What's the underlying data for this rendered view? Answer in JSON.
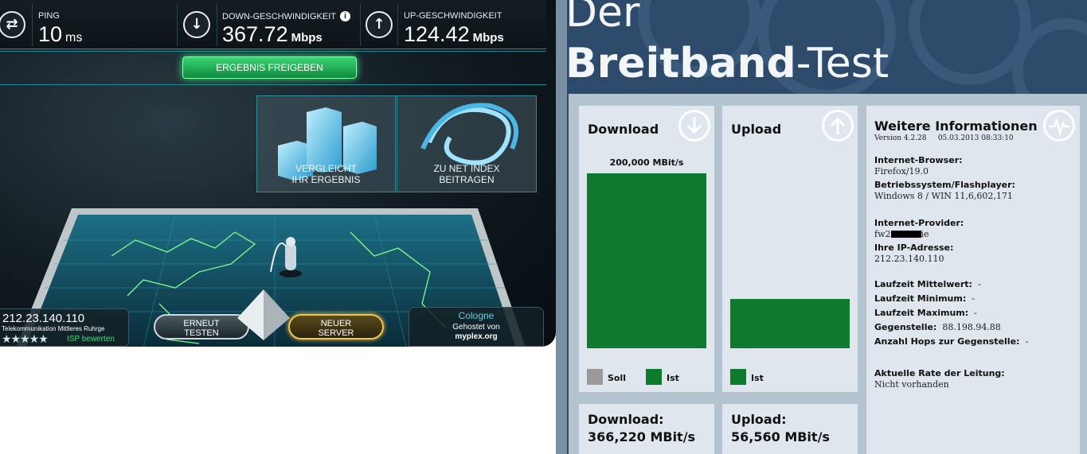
{
  "speedtest": {
    "ping": {
      "label": "PING",
      "value": "10",
      "unit": "ms",
      "icon": "exchange-arrows-icon"
    },
    "download": {
      "label": "DOWN-GESCHWINDIGKEIT",
      "value": "367.72",
      "unit": "Mbps",
      "icon": "arrow-down-icon"
    },
    "upload": {
      "label": "UP-GESCHWINDIGKEIT",
      "value": "124.42",
      "unit": "Mbps",
      "icon": "arrow-up-icon"
    },
    "info_glyph": "i",
    "share_button": "ERGEBNIS FREIGEBEN",
    "tile_compare": {
      "line1": "VERGLEICHT",
      "line2": "IHR ERGEBNIS"
    },
    "tile_netindex": {
      "line1": "ZU NET INDEX",
      "line2": "BEITRAGEN"
    },
    "client": {
      "ip": "212.23.140.110",
      "isp": "Telekommunikation Mittleres Ruhrge",
      "stars": "★★★★★",
      "rate": "ISP bewerten"
    },
    "retest_button": {
      "line1": "ERNEUT",
      "line2": "TESTEN"
    },
    "new_server_button": {
      "line1": "NEUER",
      "line2": "SERVER"
    },
    "server": {
      "city": "Cologne",
      "hosted_line1": "Gehostet von",
      "hosted_line2": "myplex.org"
    }
  },
  "breitband": {
    "title_line1": "Der",
    "title_bold": "Breitband",
    "title_rest": "-Test",
    "download_card": {
      "heading": "Download",
      "bar_label": "200,000 MBit/s",
      "legend_soll": "Soll",
      "legend_ist": "Ist"
    },
    "upload_card": {
      "heading": "Upload",
      "legend_ist": "Ist"
    },
    "download_result": {
      "label": "Download:",
      "value": "366,220 MBit/s"
    },
    "upload_result": {
      "label": "Upload:",
      "value": "56,560 MBit/s"
    },
    "info": {
      "heading": "Weitere Informationen",
      "version": "Version 4.2.28",
      "date": "05.03.2013 08:33:10",
      "browser_label": "Internet-Browser:",
      "browser_value": "Firefox/19.0",
      "os_label": "Betriebssystem/Flashplayer:",
      "os_value": "Windows 8 / WIN 11,6,602,171",
      "provider_label": "Internet-Provider:",
      "provider_prefix": "fw2",
      "provider_suffix": "ie",
      "ip_label": "Ihre IP-Adresse:",
      "ip_value": "212.23.140.110",
      "avg_label": "Laufzeit Mittelwert:",
      "avg_value": "-",
      "min_label": "Laufzeit Minimum:",
      "min_value": "-",
      "max_label": "Laufzeit Maximum:",
      "max_value": "-",
      "peer_label": "Gegenstelle:",
      "peer_value": "88.198.94.88",
      "hops_label": "Anzahl Hops zur Gegenstelle:",
      "hops_value": "-",
      "rate_label": "Aktuelle Rate der Leitung:",
      "rate_value": "Nicht vorhanden"
    },
    "colors": {
      "ist": "#0e7a2d",
      "soll": "#9a9a9a"
    }
  },
  "chart_data": [
    {
      "type": "bar",
      "title": "Download",
      "categories": [
        "Ist"
      ],
      "series": [
        {
          "name": "Ist",
          "values": [
            200
          ]
        }
      ],
      "ylabel": "MBit/s",
      "data_label": "200,000 MBit/s",
      "legend": [
        "Soll",
        "Ist"
      ]
    },
    {
      "type": "bar",
      "title": "Upload",
      "categories": [
        "Ist"
      ],
      "series": [
        {
          "name": "Ist",
          "values": [
            56.56
          ]
        }
      ],
      "ylabel": "MBit/s",
      "legend": [
        "Ist"
      ]
    }
  ]
}
